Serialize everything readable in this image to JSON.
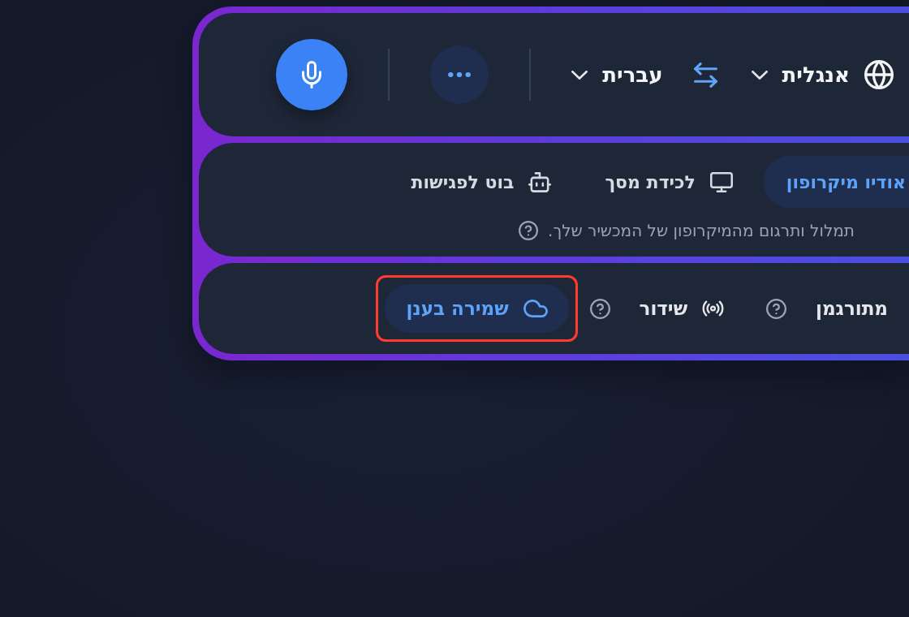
{
  "language_bar": {
    "source_language": {
      "label": "אנגלית"
    },
    "target_language": {
      "label": "עברית"
    }
  },
  "input_sources": {
    "tabs": [
      {
        "label": "אודיו מיקרופון",
        "kind": "microphone",
        "selected": true
      },
      {
        "label": "לכידת מסך",
        "kind": "screen",
        "selected": false
      },
      {
        "label": "בוט לפגישות",
        "kind": "bot",
        "selected": false
      }
    ],
    "description": "תמלול ותרגום מהמיקרופון של המכשיר שלך."
  },
  "modes": [
    {
      "label": "מתורגמן",
      "kind": "interpreter",
      "on": false,
      "help": true,
      "highlighted": false
    },
    {
      "label": "שידור",
      "kind": "broadcast",
      "on": false,
      "help": true,
      "highlighted": false
    },
    {
      "label": "שמירה בענן",
      "kind": "cloud",
      "on": true,
      "help": false,
      "highlighted": true
    }
  ]
}
